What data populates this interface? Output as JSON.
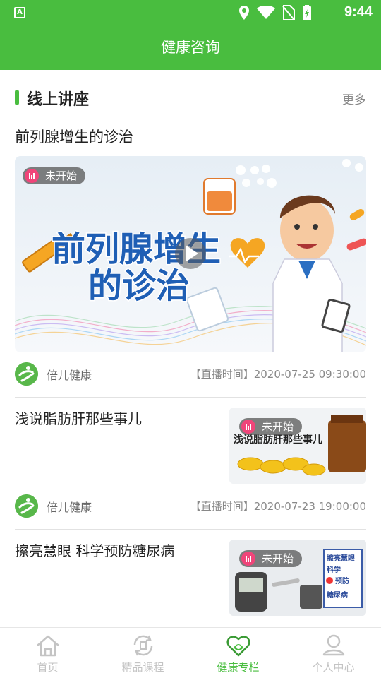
{
  "status_bar": {
    "time": "9:44",
    "notification_icon": "A"
  },
  "header": {
    "title": "健康咨询"
  },
  "section": {
    "title": "线上讲座",
    "more_label": "更多"
  },
  "featured": {
    "title": "前列腺增生的诊治",
    "badge": "未开始",
    "banner_text_line1": "前列腺增生",
    "banner_text_line2": "的诊治",
    "source": "倍儿健康",
    "time_label": "【直播时间】2020-07-25 09:30:00"
  },
  "items": [
    {
      "title": "浅说脂肪肝那些事儿",
      "badge": "未开始",
      "thumb_text": "浅说脂肪肝那些事儿",
      "source": "倍儿健康",
      "time_label": "【直播时间】2020-07-23 19:00:00"
    },
    {
      "title": "擦亮慧眼 科学预防糖尿病",
      "badge": "未开始",
      "thumb_text_lines": [
        "擦亮慧眼",
        "科学",
        "预防",
        "糖尿病"
      ]
    }
  ],
  "tabs": [
    {
      "label": "首页",
      "icon": "home-icon",
      "active": false
    },
    {
      "label": "精品课程",
      "icon": "refresh-course-icon",
      "active": false
    },
    {
      "label": "健康专栏",
      "icon": "health-heart-icon",
      "active": true
    },
    {
      "label": "个人中心",
      "icon": "user-icon",
      "active": false
    }
  ],
  "colors": {
    "brand_green": "#49bd3f",
    "badge_pink": "#f0457a"
  }
}
